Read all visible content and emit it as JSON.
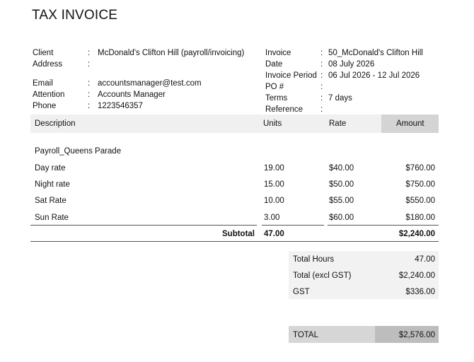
{
  "title": "TAX INVOICE",
  "client_info": {
    "client_label": "Client",
    "client_value": "McDonald's Clifton Hill  (payroll/invoicing)",
    "address_label": "Address",
    "address_value": "",
    "email_label": "Email",
    "email_value": "accountsmanager@test.com",
    "attention_label": "Attention",
    "attention_value": "Accounts Manager",
    "phone_label": "Phone",
    "phone_value": "1223546357"
  },
  "invoice_info": {
    "invoice_label": "Invoice",
    "invoice_value": "50_McDonald's Clifton Hill",
    "date_label": "Date",
    "date_value": "08 July 2026",
    "period_label": "Invoice Period",
    "period_value": "06 Jul 2026 - 12 Jul 2026",
    "po_label": "PO #",
    "po_value": "",
    "terms_label": "Terms",
    "terms_value": "7 days",
    "reference_label": "Reference",
    "reference_value": ""
  },
  "colon": ":",
  "table": {
    "headers": {
      "description": "Description",
      "units": "Units",
      "rate": "Rate",
      "amount": "Amount"
    },
    "group_label": "Payroll_Queens Parade",
    "rows": [
      {
        "description": "Day rate",
        "units": "19.00",
        "rate": "$40.00",
        "amount": "$760.00"
      },
      {
        "description": "Night rate",
        "units": "15.00",
        "rate": "$50.00",
        "amount": "$750.00"
      },
      {
        "description": "Sat Rate",
        "units": "10.00",
        "rate": "$55.00",
        "amount": "$550.00"
      },
      {
        "description": "Sun Rate",
        "units": "3.00",
        "rate": "$60.00",
        "amount": "$180.00"
      }
    ],
    "subtotal_label": "Subtotal",
    "subtotal_units": "47.00",
    "subtotal_amount": "$2,240.00"
  },
  "summary": {
    "total_hours_label": "Total Hours",
    "total_hours_value": "47.00",
    "total_excl_label": "Total (excl GST)",
    "total_excl_value": "$2,240.00",
    "gst_label": "GST",
    "gst_value": "$336.00",
    "total_label": "TOTAL",
    "total_value": "$2,576.00"
  }
}
